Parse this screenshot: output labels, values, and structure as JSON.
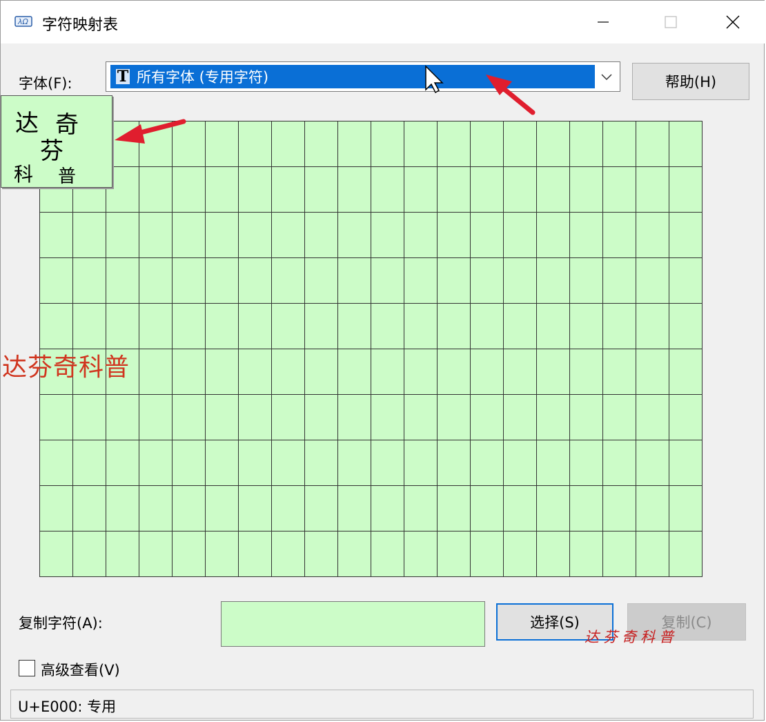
{
  "window": {
    "title": "字符映射表",
    "icon": "character-map-app-icon",
    "controls": [
      "minimize-icon",
      "maximize-icon",
      "close-icon"
    ]
  },
  "font_row": {
    "label": "字体(F):",
    "selected_font": "所有字体 (专用字符)",
    "font_type_glyph": "T",
    "help_label": "帮助(H)"
  },
  "grid": {
    "rows": 10,
    "cols": 20,
    "cell_color": "#ccfcc8"
  },
  "copy_row": {
    "label": "复制字符(A):",
    "value": "",
    "select_label": "选择(S)",
    "copy_label": "复制(C)"
  },
  "advanced": {
    "label": "高级查看(V)",
    "checked": false
  },
  "status": {
    "text": "U+E000: 专用"
  },
  "watermarks": {
    "note_chars": [
      "达",
      "奇",
      "芬",
      "科",
      "普"
    ],
    "red_text": "达芬奇科普",
    "signature": "达芬奇科普"
  },
  "colors": {
    "selection": "#0a6fd6",
    "annotation_arrow": "#e01e2e"
  }
}
